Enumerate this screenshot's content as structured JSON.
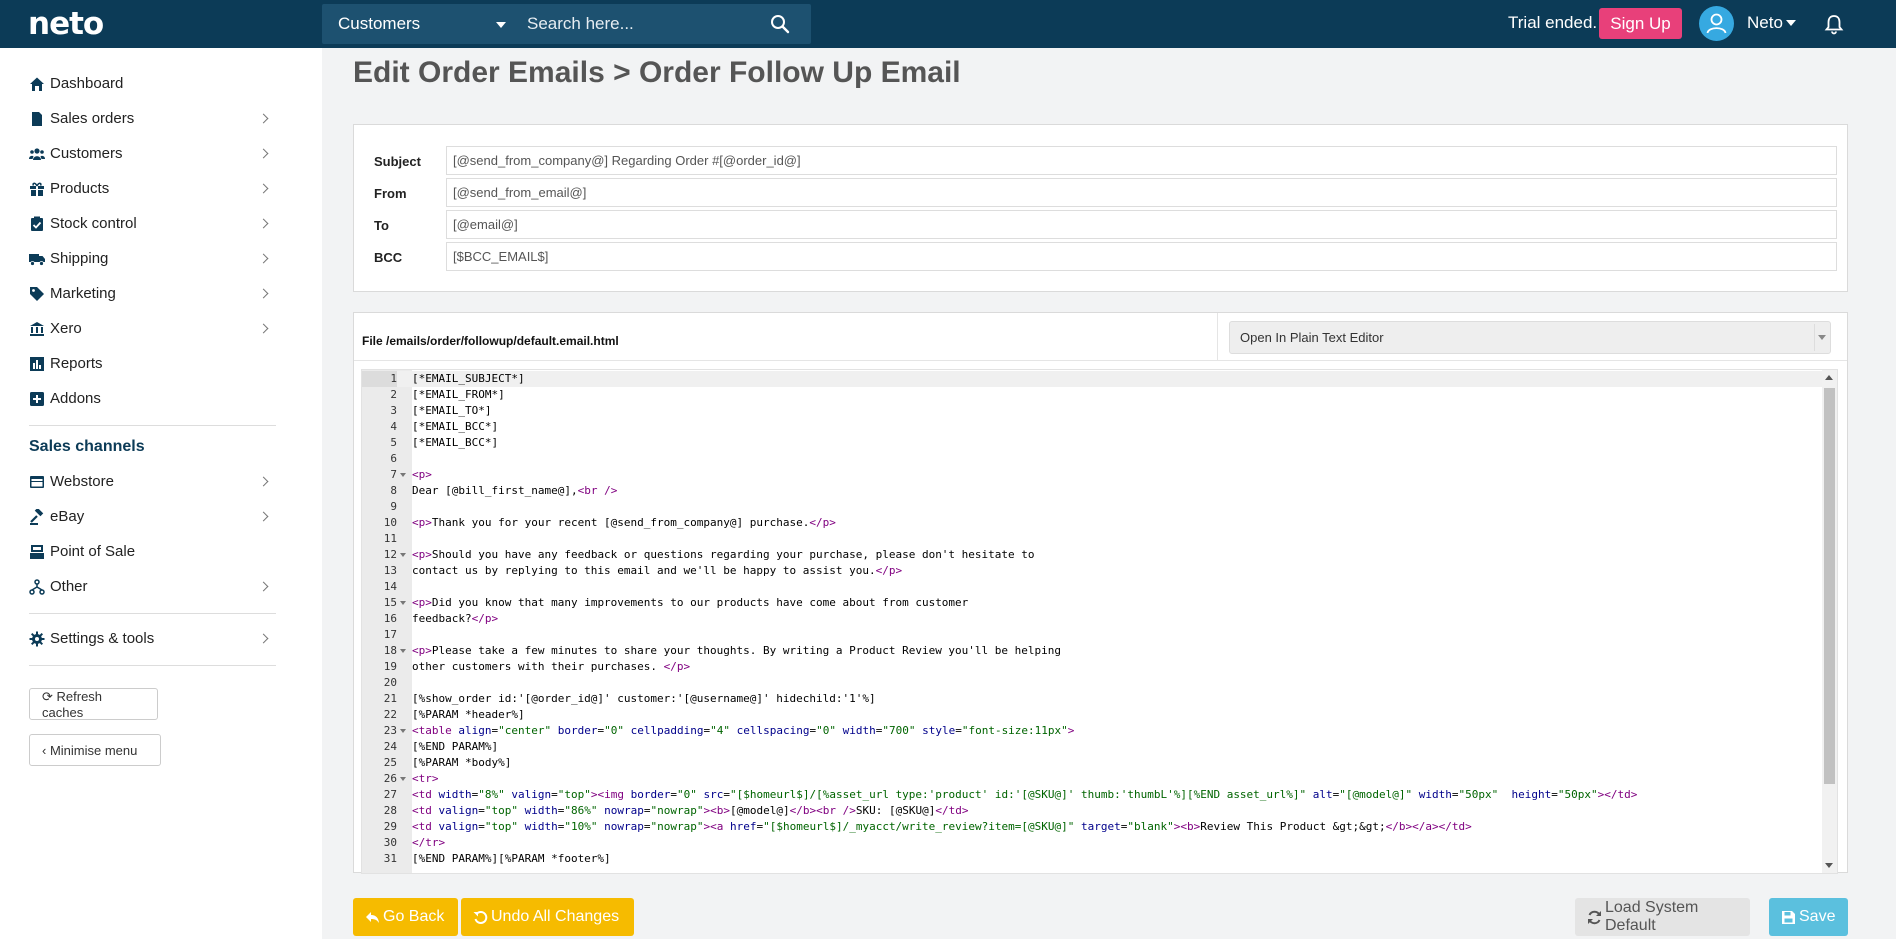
{
  "header": {
    "logo": "neto",
    "search_scope": "Customers",
    "search_placeholder": "Search here...",
    "trial_text": "Trial ended.",
    "signup_label": "Sign Up",
    "user_name": "Neto"
  },
  "sidebar": {
    "items": [
      {
        "label": "Dashboard",
        "icon": "home-icon"
      },
      {
        "label": "Sales orders",
        "icon": "document-icon"
      },
      {
        "label": "Customers",
        "icon": "users-icon"
      },
      {
        "label": "Products",
        "icon": "gift-icon"
      },
      {
        "label": "Stock control",
        "icon": "clipboard-check-icon"
      },
      {
        "label": "Shipping",
        "icon": "truck-icon"
      },
      {
        "label": "Marketing",
        "icon": "tag-icon"
      },
      {
        "label": "Xero",
        "icon": "bank-icon"
      },
      {
        "label": "Reports",
        "icon": "bar-chart-icon"
      },
      {
        "label": "Addons",
        "icon": "plus-square-icon"
      }
    ],
    "channels_heading": "Sales channels",
    "channels": [
      {
        "label": "Webstore",
        "icon": "window-icon"
      },
      {
        "label": "eBay",
        "icon": "gavel-icon"
      },
      {
        "label": "Point of Sale",
        "icon": "register-icon"
      },
      {
        "label": "Other",
        "icon": "sitemap-icon"
      }
    ],
    "settings_label": "Settings & tools",
    "refresh_label": "Refresh caches",
    "minimise_label": "Minimise menu"
  },
  "main": {
    "title": "Edit Order Emails > Order Follow Up Email",
    "fields": {
      "subject_label": "Subject",
      "subject_value": "[@send_from_company@] Regarding Order #[@order_id@]",
      "from_label": "From",
      "from_value": "[@send_from_email@]",
      "to_label": "To",
      "to_value": "[@email@]",
      "bcc_label": "BCC",
      "bcc_value": "[$BCC_EMAIL$]"
    },
    "file_label": "File /emails/order/followup/default.email.html",
    "editor_mode": "Open In Plain Text Editor",
    "code_lines": [
      "[*EMAIL_SUBJECT*]",
      "[*EMAIL_FROM*]",
      "[*EMAIL_TO*]",
      "[*EMAIL_BCC*]",
      "[*EMAIL_BCC*]",
      "",
      "<p>",
      "Dear [@bill_first_name@],<br />",
      "",
      "<p>Thank you for your recent [@send_from_company@] purchase.</p>",
      "",
      "<p>Should you have any feedback or questions regarding your purchase, please don't hesitate to",
      "contact us by replying to this email and we'll be happy to assist you.</p>",
      "",
      "<p>Did you know that many improvements to our products have come about from customer",
      "feedback?</p>",
      "",
      "<p>Please take a few minutes to share your thoughts. By writing a Product Review you'll be helping",
      "other customers with their purchases. </p>",
      "",
      "[%show_order id:'[@order_id@]' customer:'[@username@]' hidechild:'1'%]",
      "[%PARAM *header%]",
      "<table align=\"center\" border=\"0\" cellpadding=\"4\" cellspacing=\"0\" width=\"700\" style=\"font-size:11px\">",
      "[%END PARAM%]",
      "[%PARAM *body%]",
      "<tr>",
      "<td width=\"8%\" valign=\"top\"><img border=\"0\" src=\"[$homeurl$]/[%asset_url type:'product' id:'[@SKU@]' thumb:'thumbL'%][%END asset_url%]\" alt=\"[@model@]\" width=\"50px\"  height=\"50px\"></td>",
      "<td valign=\"top\" width=\"86%\" nowrap=\"nowrap\"><b>[@model@]</b><br />SKU: [@SKU@]</td>",
      "<td valign=\"top\" width=\"10%\" nowrap=\"nowrap\"><a href=\"[$homeurl$]/_myacct/write_review?item=[@SKU@]\" target=\"blank\"><b>Review This Product &gt;&gt;</b></a></td>",
      "</tr>",
      "[%END PARAM%][%PARAM *footer%]"
    ],
    "fold_lines": [
      7,
      12,
      15,
      18,
      23,
      26
    ],
    "buttons": {
      "go_back": "Go Back",
      "undo": "Undo All Changes",
      "load_default": "Load System Default",
      "save": "Save"
    }
  }
}
